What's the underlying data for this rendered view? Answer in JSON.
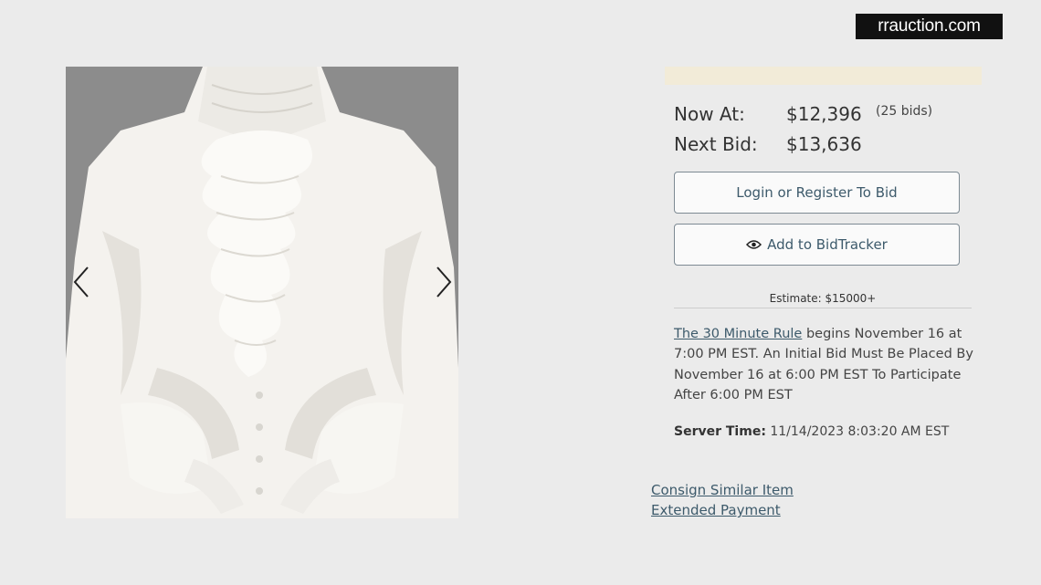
{
  "watermark": "rrauction.com",
  "gallery": {
    "image_alt": "White ruffled poet shirt on mannequin",
    "prev_icon": "chevron-left-icon",
    "next_icon": "chevron-right-icon"
  },
  "bidding": {
    "now_at_label": "Now At:",
    "now_at_value": "$12,396",
    "bid_count": "(25 bids)",
    "next_bid_label": "Next Bid:",
    "next_bid_value": "$13,636"
  },
  "buttons": {
    "login": "Login or Register To Bid",
    "bidtracker": "Add to BidTracker",
    "bidtracker_icon": "eye-icon"
  },
  "estimate": "Estimate: $15000+",
  "rule": {
    "link": "The 30 Minute Rule",
    "text": " begins November 16 at 7:00 PM EST. An Initial Bid Must Be Placed By November 16 at 6:00 PM EST To Participate After 6:00 PM EST"
  },
  "server_time": {
    "label": "Server Time:",
    "value": " 11/14/2023 8:03:20 AM EST"
  },
  "links": {
    "consign": "Consign Similar Item",
    "extended_payment": "Extended Payment"
  },
  "colors": {
    "background": "#ebebeb",
    "link": "#3d5a6b",
    "notice_bar": "#f2ebd8"
  }
}
